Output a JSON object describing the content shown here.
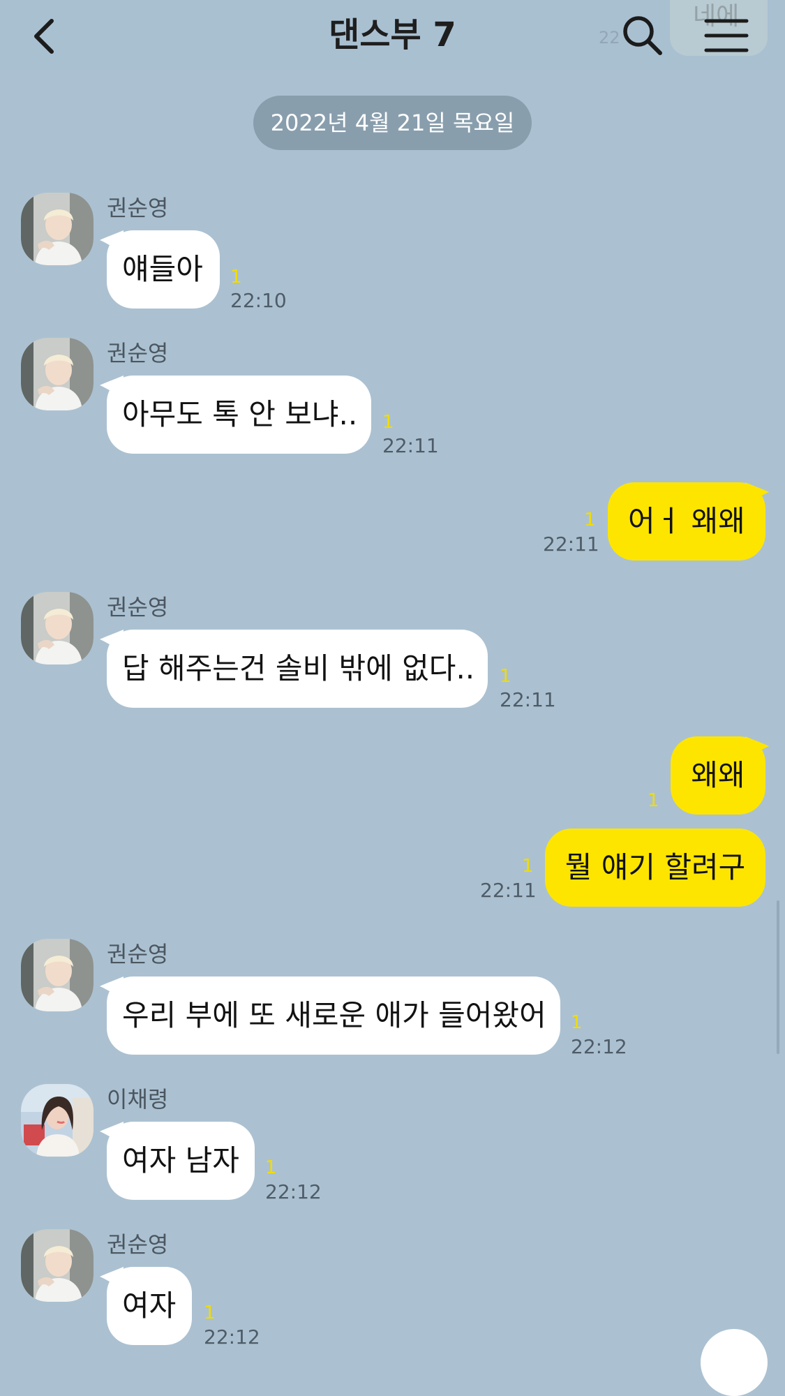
{
  "header": {
    "title": "댄스부 7",
    "ghost_bubble": "네에",
    "ghost_time": "22"
  },
  "date_divider": "2022년 4월 21일 목요일",
  "sender_names": {
    "kwon": "권순영",
    "lee": "이채령"
  },
  "messages": [
    {
      "sender": "권순영",
      "text": "얘들아",
      "unread": "1",
      "time": "22:10"
    },
    {
      "sender": "권순영",
      "text": "아무도 톡 안 보냐..",
      "unread": "1",
      "time": "22:11"
    },
    {
      "text": "어ㅓ 왜왜",
      "unread": "1",
      "time": "22:11"
    },
    {
      "sender": "권순영",
      "text": "답 해주는건 솔비 밖에 없다..",
      "unread": "1",
      "time": "22:11"
    },
    {
      "text": "왜왜",
      "unread": "1"
    },
    {
      "text": "뭘 얘기 할려구",
      "unread": "1",
      "time": "22:11"
    },
    {
      "sender": "권순영",
      "text": "우리 부에 또 새로운 애가 들어왔어",
      "unread": "1",
      "time": "22:12"
    },
    {
      "sender": "이채령",
      "text": "여자 남자",
      "unread": "1",
      "time": "22:12"
    },
    {
      "sender": "권순영",
      "text": "여자",
      "unread": "1",
      "time": "22:12"
    }
  ],
  "colors": {
    "background": "#abc1d1",
    "outgoing_bubble": "#fee500",
    "incoming_bubble": "#ffffff",
    "unread_count": "#f2dc00"
  },
  "icons": {
    "back": "chevron-left-icon",
    "search": "search-icon",
    "menu": "hamburger-menu-icon"
  }
}
